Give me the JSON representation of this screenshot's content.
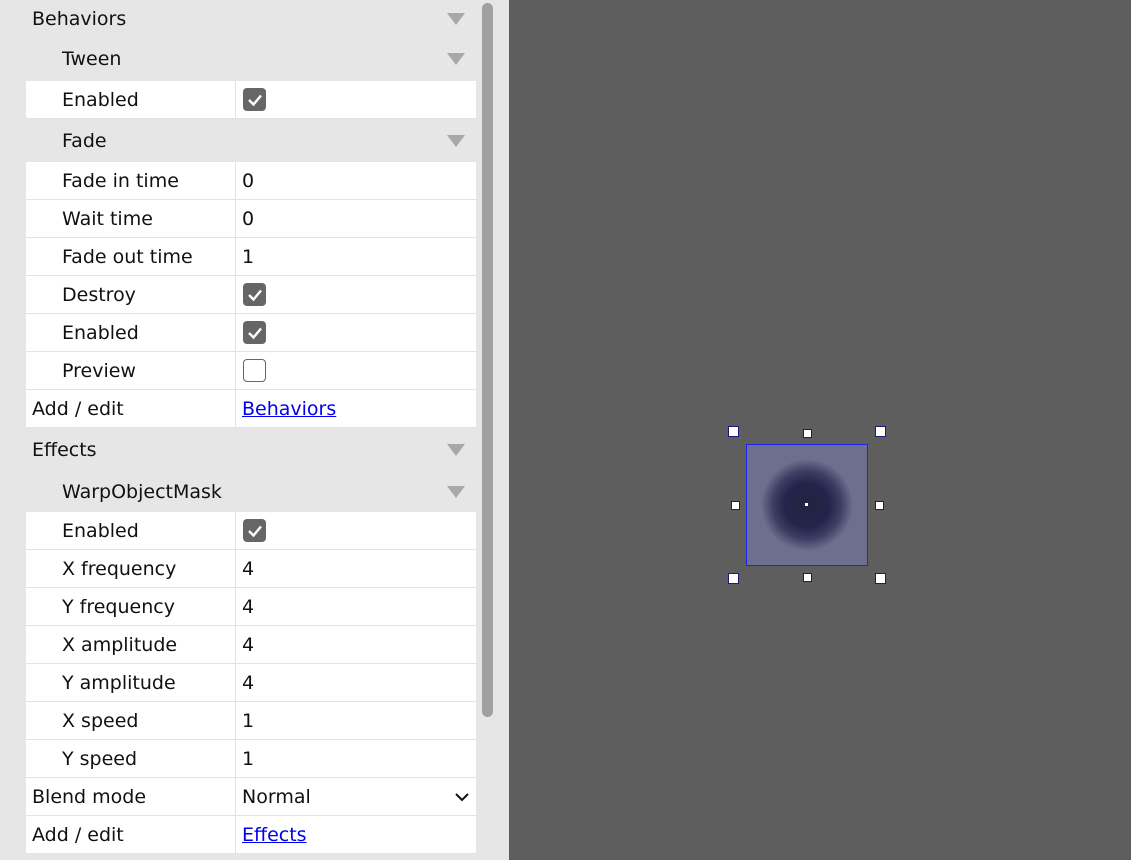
{
  "behaviors": {
    "section_label": "Behaviors",
    "tween": {
      "label": "Tween",
      "enabled_label": "Enabled",
      "enabled": true
    },
    "fade": {
      "label": "Fade",
      "fade_in_time_label": "Fade in time",
      "fade_in_time": "0",
      "wait_time_label": "Wait time",
      "wait_time": "0",
      "fade_out_time_label": "Fade out time",
      "fade_out_time": "1",
      "destroy_label": "Destroy",
      "destroy": true,
      "enabled_label": "Enabled",
      "enabled": true,
      "preview_label": "Preview",
      "preview": false
    },
    "add_edit_label": "Add / edit",
    "add_edit_link": "Behaviors"
  },
  "effects": {
    "section_label": "Effects",
    "warp": {
      "label": "WarpObjectMask",
      "enabled_label": "Enabled",
      "enabled": true,
      "x_frequency_label": "X frequency",
      "x_frequency": "4",
      "y_frequency_label": "Y frequency",
      "y_frequency": "4",
      "x_amplitude_label": "X amplitude",
      "x_amplitude": "4",
      "y_amplitude_label": "Y amplitude",
      "y_amplitude": "4",
      "x_speed_label": "X speed",
      "x_speed": "1",
      "y_speed_label": "Y speed",
      "y_speed": "1"
    },
    "blend_mode_label": "Blend mode",
    "blend_mode": "Normal",
    "add_edit_label": "Add / edit",
    "add_edit_link": "Effects"
  },
  "icons": {
    "collapse": "triangle-down-icon",
    "checkbox": "check-icon",
    "dropdown": "chevron-down-icon"
  },
  "colors": {
    "canvas_bg": "#5e5e5e",
    "panel_bg": "#e6e6e6",
    "selection_border": "#2222ee",
    "link": "#0000ee",
    "sprite_fill": "#6e6f8e",
    "sprite_core": "#23244a"
  }
}
